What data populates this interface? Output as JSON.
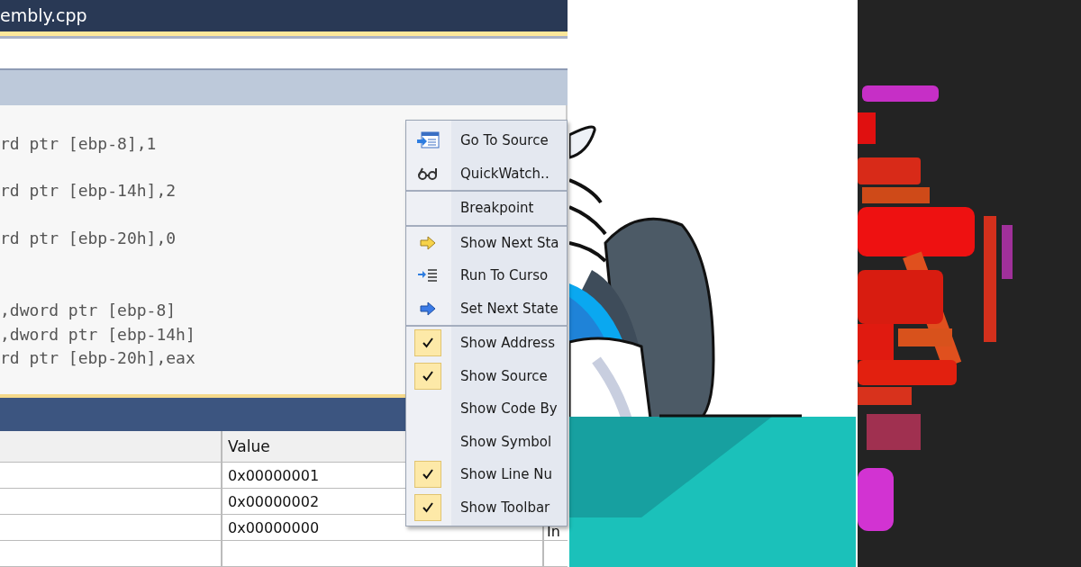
{
  "editor": {
    "tab_title": "embly.cpp",
    "code_blocks": [
      [
        "rd ptr [ebp-8],1"
      ],
      [
        "rd ptr [ebp-14h],2"
      ],
      [
        "rd ptr [ebp-20h],0"
      ],
      [
        ",dword ptr [ebp-8]",
        ",dword ptr [ebp-14h]",
        "rd ptr [ebp-20h],eax"
      ]
    ]
  },
  "context_menu": {
    "items": [
      {
        "label": "Go To Source",
        "kind": "goto",
        "checked": false,
        "separator_after": false
      },
      {
        "label": "QuickWatch..",
        "kind": "watch",
        "checked": false,
        "separator_after": true
      },
      {
        "label": "Breakpoint",
        "kind": "plain",
        "checked": false,
        "separator_after": true
      },
      {
        "label": "Show Next Sta",
        "kind": "next",
        "checked": false,
        "separator_after": false
      },
      {
        "label": "Run To Curso",
        "kind": "cursor",
        "checked": false,
        "separator_after": false
      },
      {
        "label": "Set Next State",
        "kind": "setnext",
        "checked": false,
        "separator_after": true
      },
      {
        "label": "Show Address",
        "kind": "plain",
        "checked": true,
        "separator_after": false
      },
      {
        "label": "Show Source",
        "kind": "plain",
        "checked": true,
        "separator_after": false
      },
      {
        "label": "Show Code By",
        "kind": "plain",
        "checked": false,
        "separator_after": false
      },
      {
        "label": "Show Symbol",
        "kind": "plain",
        "checked": false,
        "separator_after": false
      },
      {
        "label": "Show Line Nu",
        "kind": "plain",
        "checked": true,
        "separator_after": false
      },
      {
        "label": "Show Toolbar",
        "kind": "plain",
        "checked": true,
        "separator_after": false
      }
    ]
  },
  "locals": {
    "columns": [
      "Value"
    ],
    "rows": [
      {
        "value": "0x00000001"
      },
      {
        "value": "0x00000002"
      },
      {
        "value": "0x00000000",
        "column_3": "In"
      }
    ]
  }
}
